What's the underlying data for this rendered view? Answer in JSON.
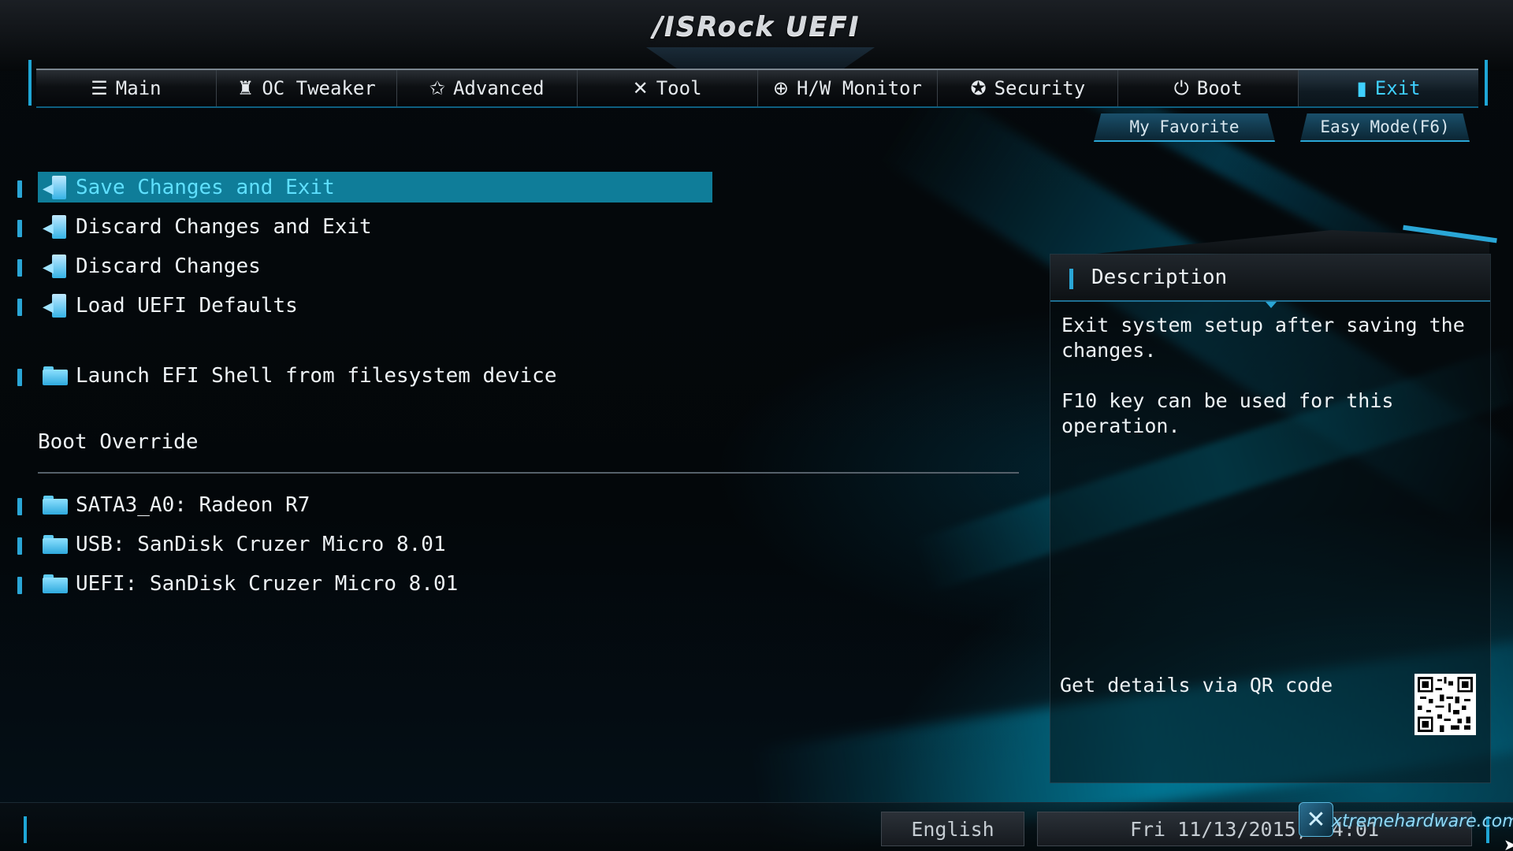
{
  "brand": "/ISRock UEFI",
  "tabs": [
    {
      "label": "Main",
      "icon": "list-icon",
      "glyph": "☰"
    },
    {
      "label": "OC Tweaker",
      "icon": "rocket-icon",
      "glyph": "♜"
    },
    {
      "label": "Advanced",
      "icon": "star-icon",
      "glyph": "✩"
    },
    {
      "label": "Tool",
      "icon": "tools-icon",
      "glyph": "✕"
    },
    {
      "label": "H/W Monitor",
      "icon": "crosshair-icon",
      "glyph": "⊕"
    },
    {
      "label": "Security",
      "icon": "shield-icon",
      "glyph": "✪"
    },
    {
      "label": "Boot",
      "icon": "power-icon",
      "glyph": "⏻"
    },
    {
      "label": "Exit",
      "icon": "exit-door-icon",
      "glyph": "▮"
    }
  ],
  "active_tab": "Exit",
  "top_buttons": {
    "favorite": "My Favorite",
    "easy_mode": "Easy Mode(F6)"
  },
  "menu": {
    "items": [
      {
        "label": "Save Changes and Exit",
        "icon": "exit-icon",
        "selected": true
      },
      {
        "label": "Discard Changes and Exit",
        "icon": "exit-icon"
      },
      {
        "label": "Discard Changes",
        "icon": "exit-icon"
      },
      {
        "label": "Load UEFI Defaults",
        "icon": "exit-icon"
      },
      {
        "label": "Launch EFI Shell from filesystem device",
        "icon": "folder-icon"
      }
    ],
    "boot_override_title": "Boot Override",
    "boot_devices": [
      {
        "label": "SATA3_A0: Radeon R7",
        "icon": "folder-icon"
      },
      {
        "label": "USB: SanDisk Cruzer Micro 8.01",
        "icon": "folder-icon"
      },
      {
        "label": "UEFI: SanDisk Cruzer Micro 8.01",
        "icon": "folder-icon"
      }
    ]
  },
  "description": {
    "title": "Description",
    "line1": "Exit system setup after saving the",
    "line2": "changes.",
    "line3": "F10 key can be used for this operation.",
    "qr_label": "Get details via QR code"
  },
  "footer": {
    "language": "English",
    "datetime": "Fri 11/13/2015, 14:01",
    "watermark": "xtremehardware.com"
  },
  "colors": {
    "accent": "#2aa6d6",
    "selected_row": "#0f7d99",
    "active_tab_text": "#3fd0ff"
  }
}
